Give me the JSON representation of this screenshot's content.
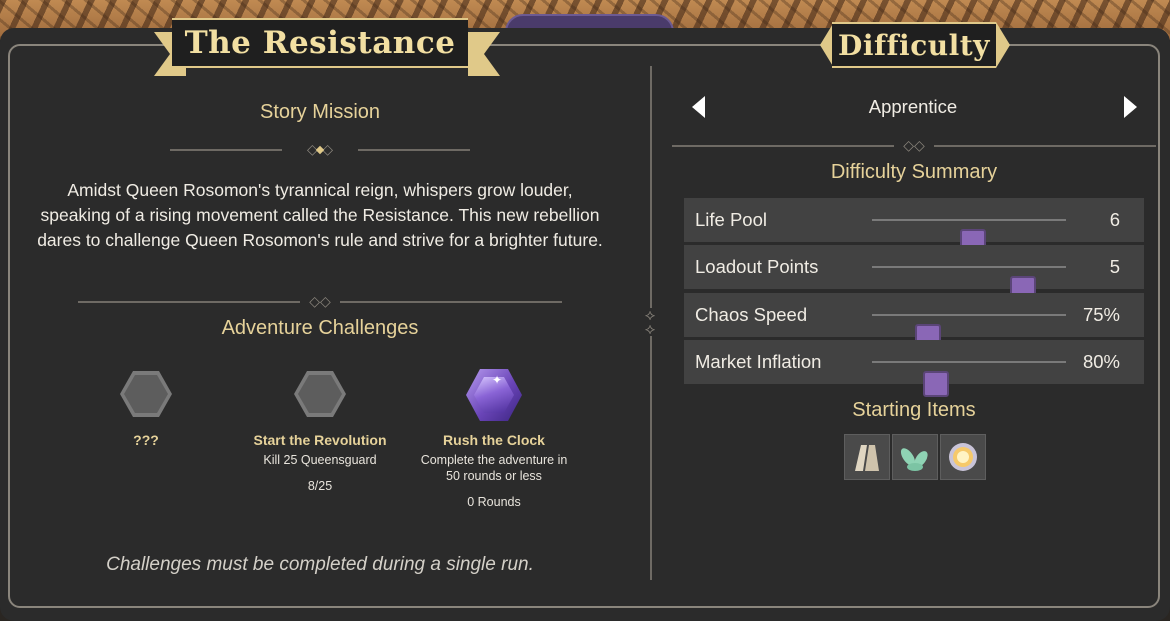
{
  "left_panel": {
    "banner_title": "The Resistance",
    "story_heading": "Story Mission",
    "story_text": "Amidst Queen Rosomon's tyrannical reign, whispers grow louder, speaking of a rising movement called the Resistance. This new rebellion dares to challenge Queen Rosomon's rule and strive for a brighter future.",
    "challenges_heading": "Adventure Challenges",
    "challenges": [
      {
        "title": "???",
        "desc": "",
        "progress": "",
        "icon": "locked-hexagon-icon"
      },
      {
        "title": "Start the Revolution",
        "desc": "Kill 25 Queensguard",
        "progress": "8/25",
        "icon": "locked-hexagon-icon"
      },
      {
        "title": "Rush the Clock",
        "desc": "Complete the adventure in 50 rounds or less",
        "progress": "0 Rounds",
        "icon": "purple-gem-icon"
      }
    ],
    "footer_note": "Challenges must be completed during a single run."
  },
  "right_panel": {
    "banner_title": "Difficulty",
    "difficulty_name": "Apprentice",
    "summary_heading": "Difficulty Summary",
    "settings": [
      {
        "label": "Life Pool",
        "value": "6",
        "level": 0.52
      },
      {
        "label": "Loadout Points",
        "value": "5",
        "level": 0.78
      },
      {
        "label": "Chaos Speed",
        "value": "75%",
        "level": 0.29
      },
      {
        "label": "Market Inflation",
        "value": "80%",
        "level": 0.33
      }
    ],
    "starting_items_heading": "Starting Items",
    "starting_items": [
      "cloak-icon",
      "herb-leaves-icon",
      "sun-orb-icon"
    ]
  },
  "colors": {
    "gold": "#e6d29a",
    "slider_knob": "#8a67b6",
    "panel_bg": "#2b2b2b",
    "row_bg": "#424242"
  }
}
